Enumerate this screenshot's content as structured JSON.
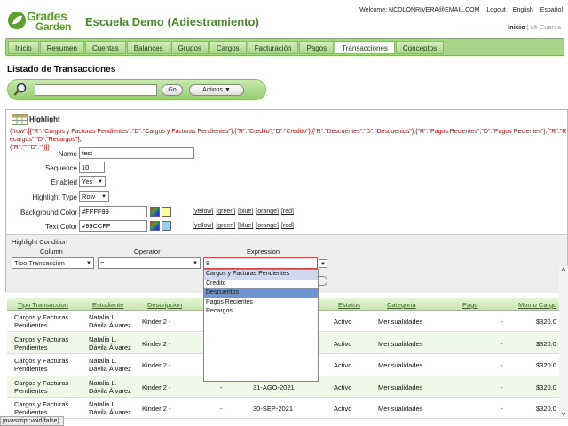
{
  "app": {
    "logo_line1": "Grades",
    "logo_line2": "Garden",
    "school": "Escuela Demo (Adiestramiento)"
  },
  "top": {
    "welcome": "Welcome: NCOLONRIVERA@EMAIL.COM",
    "logout": "Logout",
    "english": "English",
    "espanol": "Español",
    "inicio": "Inicio",
    "mi_cuenta": "| Mi Cuenta"
  },
  "nav": [
    "Inicio",
    "Resumen",
    "Cuentas",
    "Balances",
    "Grupos",
    "Cargos",
    "Facturación",
    "Pagos",
    "Transacciones",
    "Conceptos"
  ],
  "nav_active": "Transacciones",
  "page_title": "Listado de Transacciones",
  "search": {
    "value": "",
    "go": "Go",
    "actions": "Actions ▼"
  },
  "highlight": {
    "title": "Highlight",
    "json_line1": "{\"row\":[{\"R\":\"Cargos y Facturas Pendientes\",\"D\":\"Cargos y Facturas Pendientes\"},{\"R\":\"Credito\",\"D\":\"Credito\"},{\"R\":\"Descuentes\",\"D\":\"Descuentos\"},{\"R\":\"Pagos Recientes\",\"D\":\"Pagos Recientes\"},{\"R\":\"Recargos\",\"D\":\"Recargos\"},",
    "json_line2": "{\"R\":\"\",\"D\":\"\"}]}",
    "fields": {
      "name_label": "Name",
      "name_value": "test",
      "sequence_label": "Sequence",
      "sequence_value": "10",
      "enabled_label": "Enabled",
      "enabled_value": "Yes",
      "type_label": "Highlight Type",
      "type_value": "Row",
      "bg_label": "Background Color",
      "bg_value": "#FFFF99",
      "text_label": "Text Color",
      "text_value": "#99CCFF"
    },
    "color_links": [
      "[yellow]",
      "[green]",
      "[blue]",
      "[orange]",
      "[red]"
    ],
    "condition": {
      "title": "Highlight Condition",
      "column_h": "Column",
      "operator_h": "Operator",
      "expression_h": "Expression",
      "column_value": "Tipo Transaccion",
      "operator_value": "=",
      "expression_value": "8"
    },
    "dropdown_options": [
      "Cargos y Facturas Pendientes",
      "Credito",
      "Descuentos",
      "Pagos Recientes",
      "Recargos"
    ]
  },
  "table": {
    "headers": [
      "Tipo Transaccion",
      "Estudiante",
      "Descripcion",
      "Estatus",
      "Categoria",
      "Pago",
      "Monto Cargo"
    ],
    "rows": [
      {
        "tipo": "Cargos y Facturas Pendientes",
        "est1": "Natalia L.",
        "est2": "Dávila Álvarez",
        "desc": "Kinder 2 -",
        "fecha": "",
        "estatus": "Activo",
        "cat": "Mensualidades",
        "pago": "-",
        "monto": "$320.0"
      },
      {
        "tipo": "Cargos y Facturas Pendientes",
        "est1": "Natalia L.",
        "est2": "Dávila Álvarez",
        "desc": "Kinder 2 -",
        "fecha": "",
        "estatus": "Activo",
        "cat": "Mensualidades",
        "pago": "-",
        "monto": "$320.0"
      },
      {
        "tipo": "Cargos y Facturas Pendientes",
        "est1": "Natalia L.",
        "est2": "Dávila Álvarez",
        "desc": "Kinder 2 -",
        "fecha": "",
        "estatus": "Activo",
        "cat": "Mensualidades",
        "pago": "-",
        "monto": "$320.0"
      },
      {
        "tipo": "Cargos y Facturas Pendientes",
        "est1": "Natalia L.",
        "est2": "Dávila Álvarez",
        "desc": "Kinder 2 -",
        "fecha": "31-AGO-2021",
        "estatus": "Activo",
        "cat": "Mensualidades",
        "pago": "-",
        "monto": "$320.0"
      },
      {
        "tipo": "Cargos y Facturas Pendientes",
        "est1": "Natalia L.",
        "est2": "Dávila Álvarez",
        "desc": "Kinder 2 -",
        "fecha": "30-SEP-2021",
        "estatus": "Activo",
        "cat": "Mensualidades",
        "pago": "-",
        "monto": "$320.0"
      }
    ]
  },
  "status_bar": "javascript:void(false)",
  "colors": {
    "brand_green": "#5aa02c",
    "nav_green": "#a8d48a",
    "swatch_bg": "#FFFF99",
    "swatch_text": "#99CCFF",
    "highlight_select": "#6f95d0"
  }
}
